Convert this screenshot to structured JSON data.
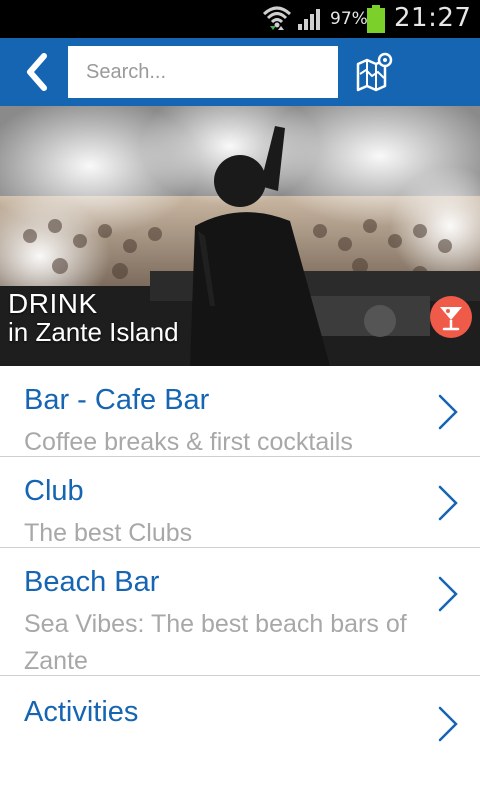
{
  "status_bar": {
    "battery_percent": "97%",
    "time": "21:27",
    "icons": [
      "wifi-icon",
      "signal-icon",
      "battery-icon"
    ]
  },
  "app_bar": {
    "back_icon": "chevron-left-icon",
    "search_placeholder": "Search...",
    "map_icon": "map-pin-icon",
    "color": "#1565b3"
  },
  "hero": {
    "title": "DRINK",
    "subtitle": "in Zante Island",
    "badge_icon": "cocktail-icon",
    "badge_color": "#f05a48"
  },
  "list": {
    "items": [
      {
        "title": "Bar - Cafe Bar",
        "subtitle": "Coffee breaks & first cocktails"
      },
      {
        "title": "Club",
        "subtitle": "The best Clubs"
      },
      {
        "title": "Beach Bar",
        "subtitle": "Sea Vibes: The best beach bars of Zante"
      },
      {
        "title": "Activities",
        "subtitle": ""
      }
    ],
    "chevron_icon": "chevron-right-icon",
    "title_color": "#1565b3",
    "subtitle_color": "#a8a8a8"
  }
}
